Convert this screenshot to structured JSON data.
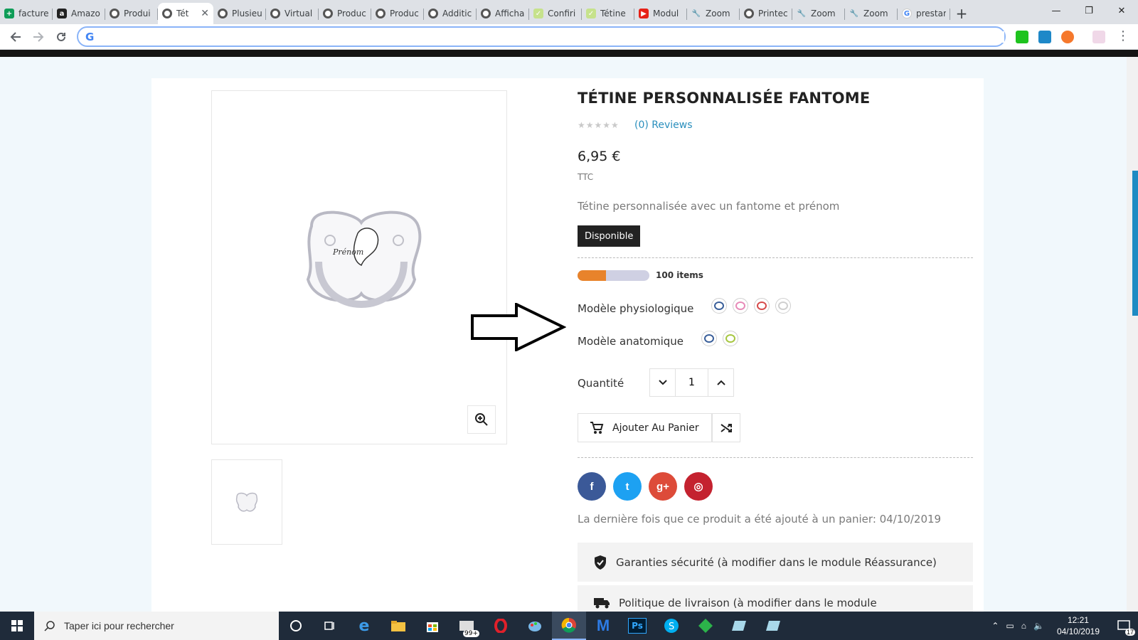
{
  "browser": {
    "tabs": [
      {
        "label": "facture",
        "icon": "sheets-icon",
        "active": false
      },
      {
        "label": "Amazo",
        "icon": "amazon-icon",
        "active": false
      },
      {
        "label": "Produi",
        "icon": "prestashop-icon",
        "active": false
      },
      {
        "label": "Tét",
        "icon": "prestashop-icon",
        "active": true
      },
      {
        "label": "Plusieu",
        "icon": "prestashop-icon",
        "active": false
      },
      {
        "label": "Virtual",
        "icon": "prestashop-icon",
        "active": false
      },
      {
        "label": "Produc",
        "icon": "prestashop-icon",
        "active": false
      },
      {
        "label": "Produc",
        "icon": "prestashop-icon",
        "active": false
      },
      {
        "label": "Additic",
        "icon": "prestashop-icon",
        "active": false
      },
      {
        "label": "Afficha",
        "icon": "prestashop-icon",
        "active": false
      },
      {
        "label": "Confiri",
        "icon": "checkmark-icon",
        "active": false
      },
      {
        "label": "Tétine",
        "icon": "checkmark-icon",
        "active": false
      },
      {
        "label": "Modul",
        "icon": "youtube-icon",
        "active": false
      },
      {
        "label": "Zoom",
        "icon": "wrench-icon",
        "active": false
      },
      {
        "label": "Printec",
        "icon": "prestashop-icon",
        "active": false
      },
      {
        "label": "Zoom",
        "icon": "wrench-icon",
        "active": false
      },
      {
        "label": "Zoom",
        "icon": "wrench-icon",
        "active": false
      },
      {
        "label": "prestar",
        "icon": "google-icon",
        "active": false
      }
    ],
    "close_glyph": "✕",
    "newtab_glyph": "+",
    "omnibox": {
      "value": "",
      "placeholder": ""
    }
  },
  "product": {
    "title": "TÉTINE PERSONNALISÉE FANTOME",
    "rating_stars": "★★★★★",
    "reviews_label": "(0) Reviews",
    "price": "6,95 €",
    "tax_label": "TTC",
    "description": "Tétine personnalisée avec un fantome et prénom",
    "availability": "Disponible",
    "stock_fill_percent": 40,
    "stock_label": "100 items",
    "image_text": "Prénom",
    "variants": [
      {
        "label": "Modèle physiologique",
        "swatches": [
          "#3a5f9a",
          "#e78ab8",
          "#d64a4a",
          "#cfcfcf"
        ]
      },
      {
        "label": "Modèle anatomique",
        "swatches": [
          "#3a5f9a",
          "#a6c640"
        ]
      }
    ],
    "quantity_label": "Quantité",
    "quantity_value": "1",
    "add_to_cart_label": "Ajouter Au Panier",
    "last_added_text": "La dernière fois que ce produit a été ajouté à un panier: 04/10/2019",
    "reassurance": [
      {
        "icon": "shield-check-icon",
        "text": "Garanties sécurité (à modifier dans le module Réassurance)"
      },
      {
        "icon": "truck-icon",
        "text": "Politique de livraison (à modifier dans le module"
      }
    ],
    "social": [
      {
        "name": "facebook",
        "glyph": "f",
        "color": "#3b5998"
      },
      {
        "name": "twitter",
        "glyph": "t",
        "color": "#1da1f2"
      },
      {
        "name": "google-plus",
        "glyph": "g+",
        "color": "#dd4b39"
      },
      {
        "name": "instagram",
        "glyph": "◎",
        "color": "#c4222f"
      }
    ]
  },
  "taskbar": {
    "search_placeholder": "Taper ici pour rechercher",
    "time": "12:21",
    "date": "04/10/2019",
    "notification_count": "17",
    "mail_badge": "99+"
  }
}
